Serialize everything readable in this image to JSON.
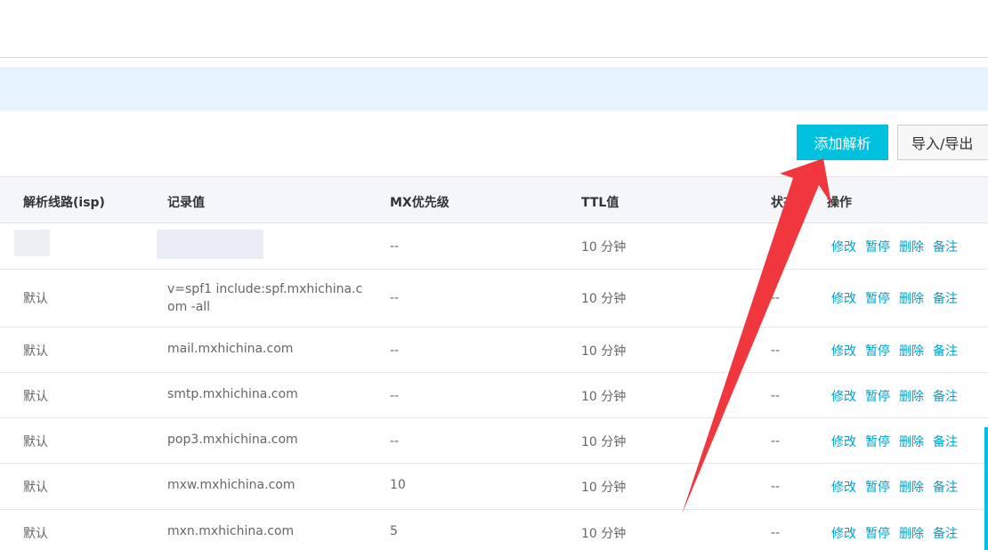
{
  "toolbar": {
    "add_label": "添加解析",
    "import_export_label": "导入/导出"
  },
  "table": {
    "headers": {
      "line": "解析线路(isp)",
      "value": "记录值",
      "mx": "MX优先级",
      "ttl": "TTL值",
      "status": "状态",
      "ops": "操作"
    },
    "actions": [
      "修改",
      "暂停",
      "删除",
      "备注"
    ],
    "rows": [
      {
        "line": "",
        "value": "",
        "mx": "--",
        "ttl": "10 分钟",
        "status": "--"
      },
      {
        "line": "默认",
        "value": "v=spf1 include:spf.mxhichina.com -all",
        "mx": "--",
        "ttl": "10 分钟",
        "status": "--"
      },
      {
        "line": "默认",
        "value": "mail.mxhichina.com",
        "mx": "--",
        "ttl": "10 分钟",
        "status": "--"
      },
      {
        "line": "默认",
        "value": "smtp.mxhichina.com",
        "mx": "--",
        "ttl": "10 分钟",
        "status": "--"
      },
      {
        "line": "默认",
        "value": "pop3.mxhichina.com",
        "mx": "--",
        "ttl": "10 分钟",
        "status": "--"
      },
      {
        "line": "默认",
        "value": "mxw.mxhichina.com",
        "mx": "10",
        "ttl": "10 分钟",
        "status": "--"
      },
      {
        "line": "默认",
        "value": "mxn.mxhichina.com",
        "mx": "5",
        "ttl": "10 分钟",
        "status": "--"
      }
    ]
  },
  "colors": {
    "primary": "#00c1de",
    "link": "#00a2ca",
    "notice_bg": "#e8f4fd",
    "header_bg": "#f5f6fa",
    "annotation_arrow": "#f0373d"
  },
  "annotation": {
    "type": "arrow",
    "points_to": "add-record-button"
  }
}
